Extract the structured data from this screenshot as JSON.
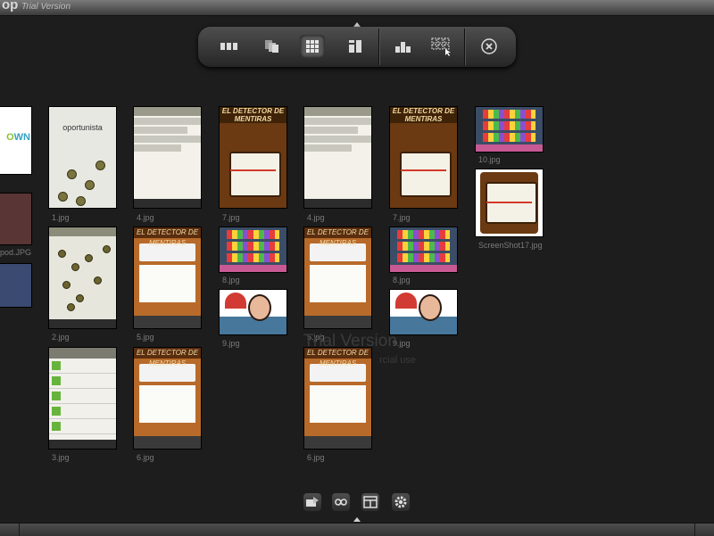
{
  "window": {
    "logo": "op",
    "title": "Trial Version"
  },
  "toolbar": {
    "buttons": [
      {
        "name": "row-view",
        "icon": "three-columns-icon"
      },
      {
        "name": "stack-view",
        "icon": "stack-icon"
      },
      {
        "name": "grid-view",
        "icon": "grid-icon",
        "active": true
      },
      {
        "name": "mosaic-view",
        "icon": "mosaic-icon"
      },
      {
        "name": "cluster-view",
        "icon": "cluster-icon"
      },
      {
        "name": "selection-grid-view",
        "icon": "dotted-grid-icon"
      },
      {
        "name": "close",
        "icon": "close-icon"
      }
    ]
  },
  "thumbnails": {
    "edge_caption": "pod.JPG",
    "col1": {
      "cap1": "1.jpg",
      "cap2": "2.jpg",
      "cap3": "3.jpg",
      "brand": "oportunista"
    },
    "col2": {
      "cap1": "4.jpg",
      "cap2": "5.jpg",
      "cap3": "6.jpg"
    },
    "col3": {
      "cap1": "7.jpg",
      "cap2": "8.jpg",
      "cap3": "9.jpg"
    },
    "col4": {
      "cap1": "4.jpg",
      "cap2": "5.jpg",
      "cap3": "6.jpg"
    },
    "col5": {
      "cap1": "7.jpg",
      "cap2": "8.jpg",
      "cap3": "9.jpg"
    },
    "col6": {
      "cap1": "10.jpg",
      "cap2": "ScreenShot17.jpg"
    },
    "detector_title": "EL DETECTOR DE MENTIRAS",
    "edge_brand_a": "O",
    "edge_brand_b": "WN"
  },
  "watermark": {
    "line1": "Trial Version",
    "line2": "rcial use"
  },
  "bottom_icons": [
    "slideshow-icon",
    "link-icon",
    "layout-icon",
    "settings-gear-icon"
  ],
  "colors": {
    "background": "#1d1d1d",
    "toolbar": "#3a3a3a",
    "caption": "#7b7b7b"
  }
}
